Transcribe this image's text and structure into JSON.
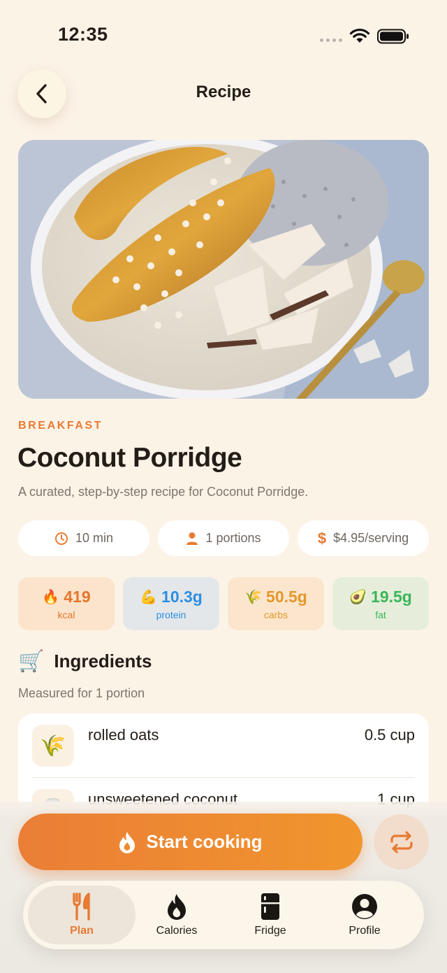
{
  "status_bar": {
    "time": "12:35"
  },
  "header": {
    "title": "Recipe"
  },
  "recipe": {
    "category": "BREAKFAST",
    "title": "Coconut Porridge",
    "description": "A curated, step-by-step recipe for Coconut Porridge.",
    "chips": {
      "time": "10 min",
      "portions": "1 portions",
      "price": "$4.95/serving"
    },
    "macros": {
      "kcal": {
        "emoji": "🔥",
        "value": "419",
        "label": "kcal"
      },
      "protein": {
        "emoji": "💪",
        "value": "10.3g",
        "label": "protein"
      },
      "carbs": {
        "emoji": "🌾",
        "value": "50.5g",
        "label": "carbs"
      },
      "fat": {
        "emoji": "🥑",
        "value": "19.5g",
        "label": "fat"
      }
    }
  },
  "ingredients_section": {
    "icon": "🛒",
    "title": "Ingredients",
    "subtitle": "Measured for 1 portion",
    "items": [
      {
        "name": "rolled oats",
        "amount": "0.5 cup",
        "icon": "🌾"
      },
      {
        "name": "unsweetened coconut",
        "amount": "1 cup",
        "icon": "🥛"
      }
    ]
  },
  "actions": {
    "start_cooking": "Start cooking"
  },
  "tab_bar": {
    "tabs": [
      {
        "label": "Plan",
        "icon": "fork-knife-icon",
        "active": true
      },
      {
        "label": "Calories",
        "icon": "flame-icon",
        "active": false
      },
      {
        "label": "Fridge",
        "icon": "fridge-icon",
        "active": false
      },
      {
        "label": "Profile",
        "icon": "profile-icon",
        "active": false
      }
    ]
  },
  "colors": {
    "accent": "#e87a33",
    "background": "#fcf3e7"
  }
}
